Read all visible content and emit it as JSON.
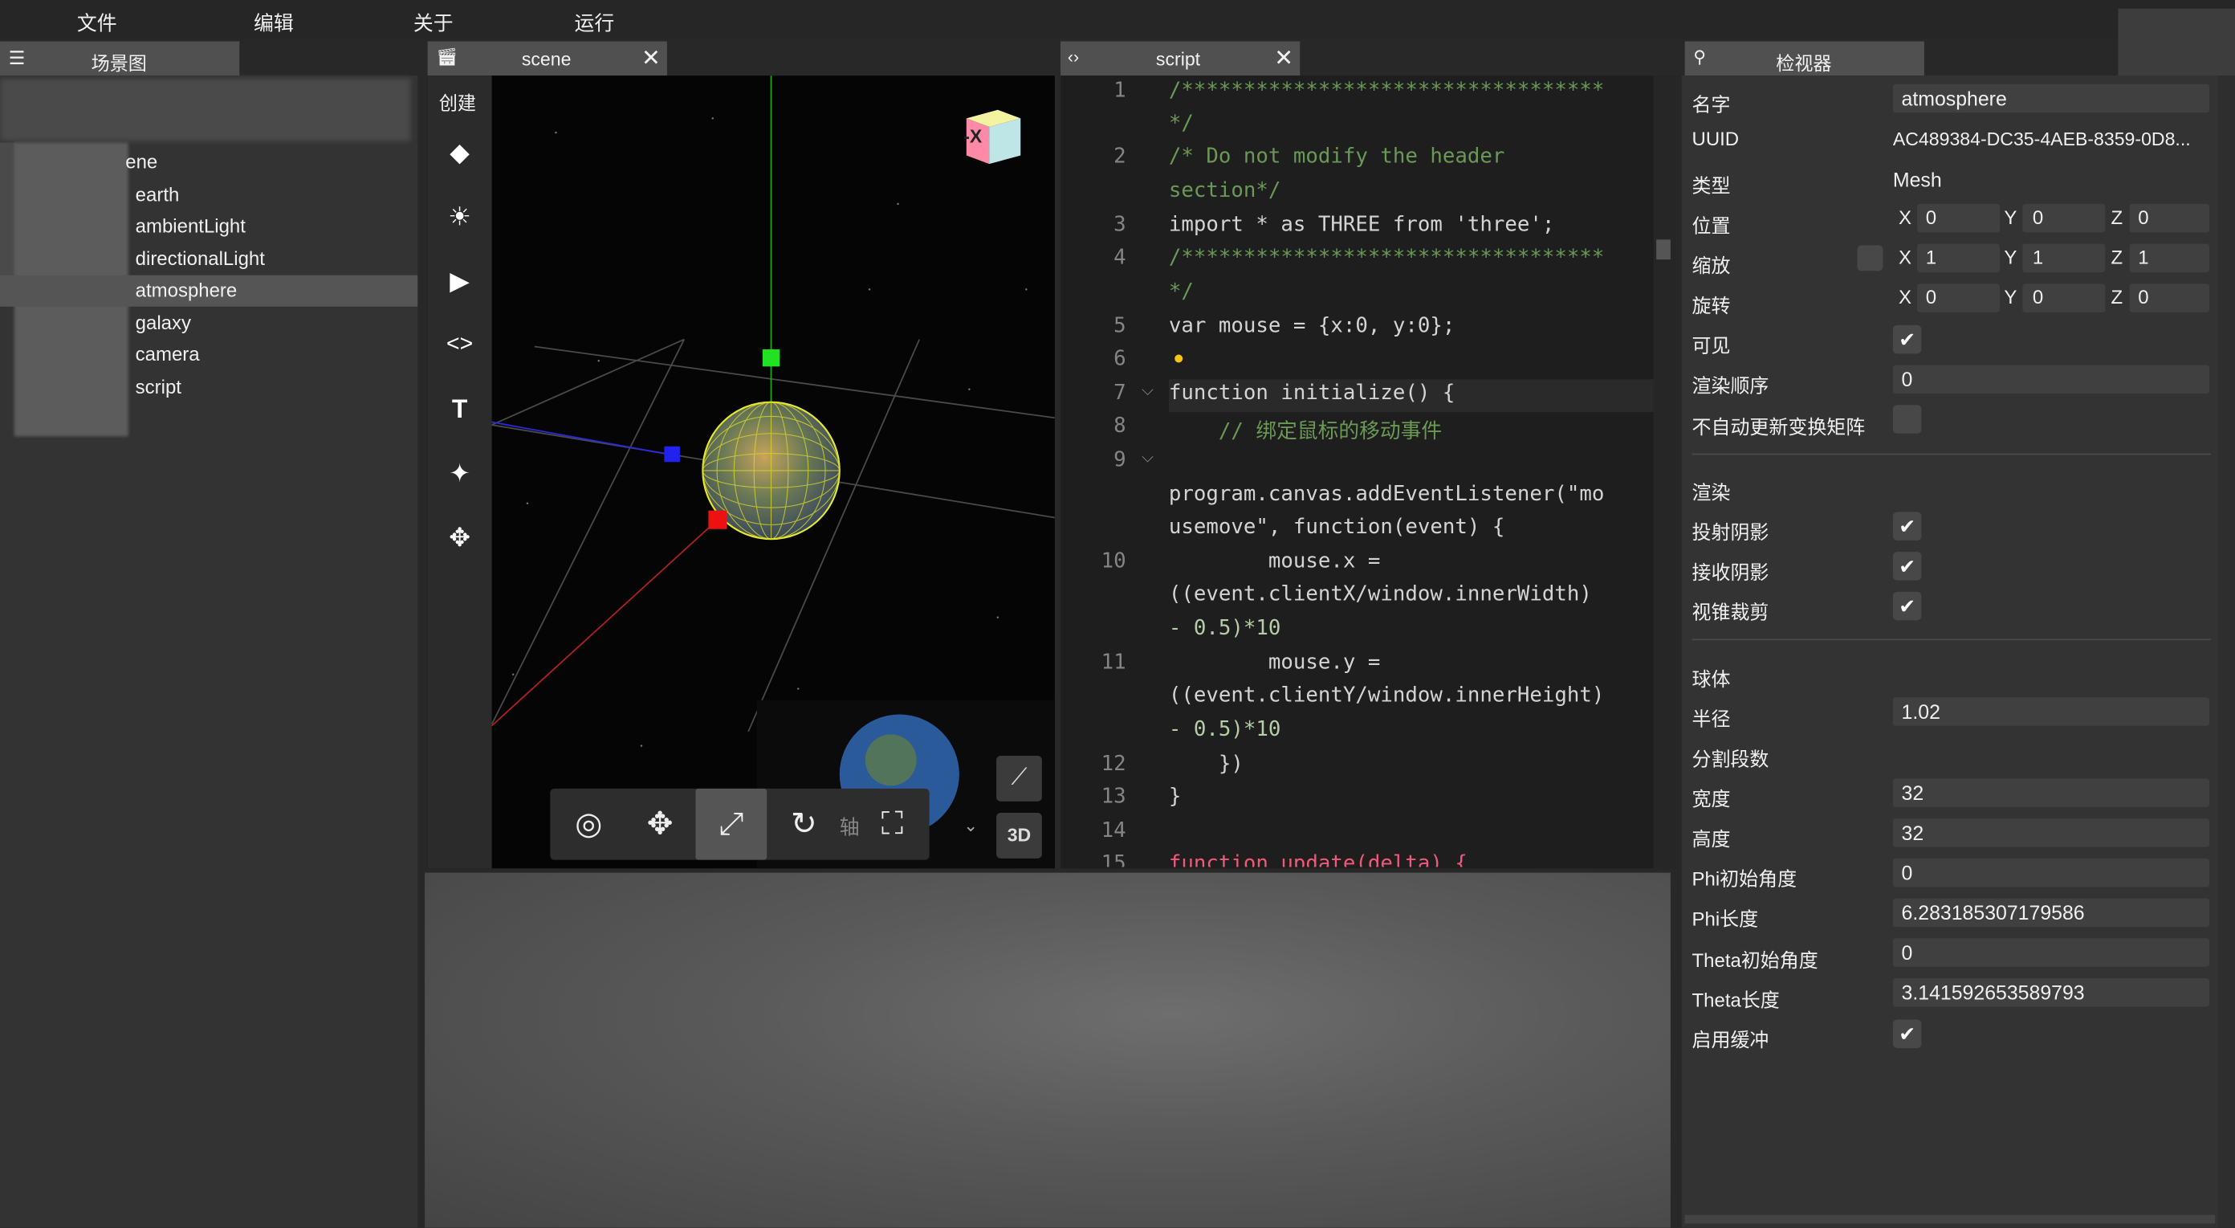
{
  "menu": {
    "file": "文件",
    "edit": "编辑",
    "about": "关于",
    "run": "运行"
  },
  "scene_graph": {
    "tab_label": "场景图",
    "root_partial": "ene",
    "items": [
      "earth",
      "ambientLight",
      "directionalLight",
      "atmosphere",
      "galaxy",
      "camera",
      "script"
    ],
    "selected": "atmosphere"
  },
  "scene_tab": {
    "label": "scene",
    "create_label": "创建",
    "gizmo_label": "-X",
    "bottom_partial_label": "轴"
  },
  "script_tab": {
    "label": "script"
  },
  "code": {
    "line_numbers": [
      "1",
      "",
      "2",
      "",
      "3",
      "4",
      "",
      "5",
      "6",
      "7",
      "8",
      "9",
      "",
      "",
      "10",
      "",
      "",
      "11",
      "",
      "",
      "12",
      "13",
      "14",
      "15"
    ],
    "lines": [
      "/**********************************",
      "*/",
      "/* Do not modify the header",
      "section*/",
      "import * as THREE from 'three';",
      "/**********************************",
      "*/",
      "var mouse = {x:0, y:0};",
      "",
      "function initialize() {",
      "    // 绑定鼠标的移动事件",
      "",
      "program.canvas.addEventListener(\"mo",
      "usemove\", function(event) {",
      "        mouse.x =",
      "((event.clientX/window.innerWidth)",
      "- 0.5)*10",
      "        mouse.y =",
      "((event.clientY/window.innerHeight)",
      "- 0.5)*10",
      "    })",
      "}",
      "",
      "function update(delta) {"
    ]
  },
  "inspector": {
    "tab_label": "检视器",
    "name_label": "名字",
    "name_value": "atmosphere",
    "uuid_label": "UUID",
    "uuid_value": "AC489384-DC35-4AEB-8359-0D8...",
    "type_label": "类型",
    "type_value": "Mesh",
    "position_label": "位置",
    "position": {
      "x": "0",
      "y": "0",
      "z": "0"
    },
    "scale_label": "缩放",
    "scale": {
      "x": "1",
      "y": "1",
      "z": "1"
    },
    "rotation_label": "旋转",
    "rotation": {
      "x": "0",
      "y": "0",
      "z": "0"
    },
    "axis_x": "X",
    "axis_y": "Y",
    "axis_z": "Z",
    "visible_label": "可见",
    "render_order_label": "渲染顺序",
    "render_order_value": "0",
    "no_auto_update_label": "不自动更新变换矩阵",
    "render_section": "渲染",
    "cast_shadow_label": "投射阴影",
    "receive_shadow_label": "接收阴影",
    "frustum_cull_label": "视锥裁剪",
    "sphere_section": "球体",
    "radius_label": "半径",
    "radius_value": "1.02",
    "segments_label": "分割段数",
    "width_label": "宽度",
    "width_value": "32",
    "height_label": "高度",
    "height_value": "32",
    "phi_start_label": "Phi初始角度",
    "phi_start_value": "0",
    "phi_length_label": "Phi长度",
    "phi_length_value": "6.283185307179586",
    "theta_start_label": "Theta初始角度",
    "theta_start_value": "0",
    "theta_length_label": "Theta长度",
    "theta_length_value": "3.141592653589793",
    "buffer_label": "启用缓冲",
    "check_mark": "✔"
  }
}
